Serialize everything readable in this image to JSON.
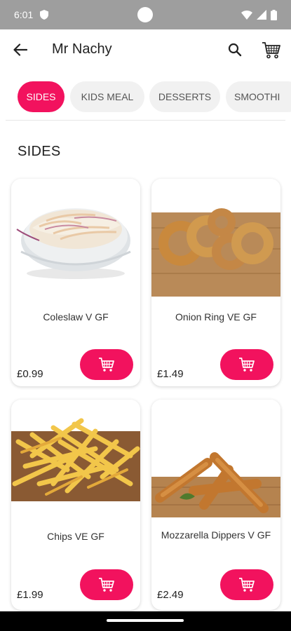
{
  "status": {
    "time": "6:01"
  },
  "app_bar": {
    "title": "Mr Nachy"
  },
  "tabs": [
    {
      "label": "SIDES",
      "active": true
    },
    {
      "label": "KIDS MEAL",
      "active": false
    },
    {
      "label": "DESSERTS",
      "active": false
    },
    {
      "label": "SMOOTHI",
      "active": false
    }
  ],
  "section": {
    "title": "SIDES"
  },
  "products": [
    {
      "name": "Coleslaw  V GF",
      "price": "£0.99",
      "image": "coleslaw-bowl"
    },
    {
      "name": "Onion Ring VE GF",
      "price": "£1.49",
      "image": "onion-rings-board"
    },
    {
      "name": "Chips VE GF",
      "price": "£1.99",
      "image": "chips-board"
    },
    {
      "name": "Mozzarella Dippers V GF",
      "price": "£2.49",
      "image": "mozzarella-dippers-board"
    }
  ],
  "colors": {
    "accent": "#f2125e",
    "status_bar": "#9e9e9e"
  }
}
